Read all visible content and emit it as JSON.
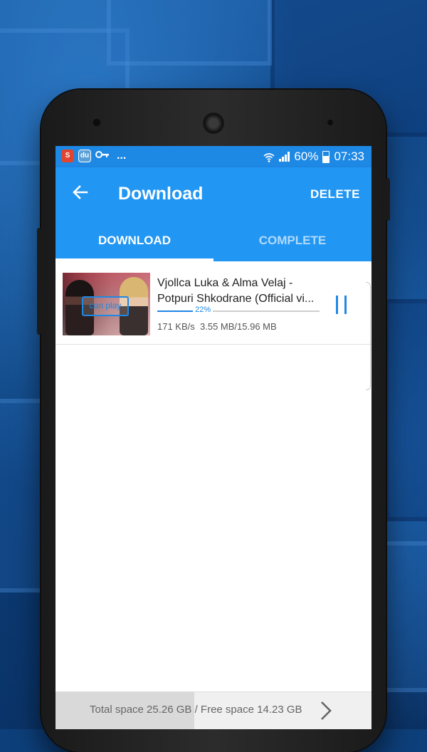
{
  "status_bar": {
    "apps": [
      "S",
      "du"
    ],
    "battery": "60%",
    "time": "07:33",
    "more": "..."
  },
  "app_bar": {
    "title": "Download",
    "delete_label": "DELETE"
  },
  "tabs": [
    {
      "label": "DOWNLOAD",
      "active": true
    },
    {
      "label": "COMPLETE",
      "active": false
    }
  ],
  "downloads": [
    {
      "title_line1": "Vjollca Luka & Alma Velaj -",
      "title_line2": "Potpuri Shkodrane (Official vi...",
      "thumbnail_badge": "can play",
      "progress": 0.22,
      "progress_label": "22%",
      "speed": "171 KB/s",
      "size": "3.55 MB/15.96 MB"
    }
  ],
  "footer": {
    "storage_text": "Total space 25.26 GB / Free space 14.23 GB",
    "used_fraction": 0.44
  },
  "colors": {
    "primary": "#2196f3",
    "status_bar": "#1e88e5",
    "accent": "#1e88e5"
  },
  "icons": {
    "back": "arrow-left-icon",
    "pause": "pause-icon",
    "next": "chevron-right-icon",
    "wifi": "wifi-icon",
    "signal": "signal-icon",
    "battery": "battery-icon",
    "key": "key-icon"
  }
}
